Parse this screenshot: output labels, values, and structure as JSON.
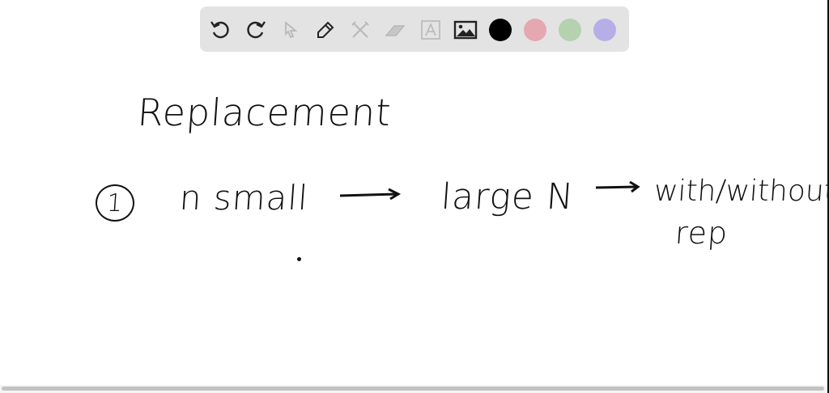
{
  "toolbar": {
    "tools": [
      "undo-icon",
      "redo-icon",
      "select-icon",
      "pen-icon",
      "tools-icon",
      "eraser-icon",
      "text-icon",
      "image-icon"
    ],
    "colors": {
      "black": "#000000",
      "pink": "#e5a7b0",
      "green": "#b5d1b0",
      "purple": "#b6aee6"
    }
  },
  "canvas": {
    "title": "Replacement",
    "item_number": "1",
    "phrase_1": "n small",
    "phrase_2": "large N",
    "phrase_3": "with/without",
    "phrase_4": "rep"
  }
}
